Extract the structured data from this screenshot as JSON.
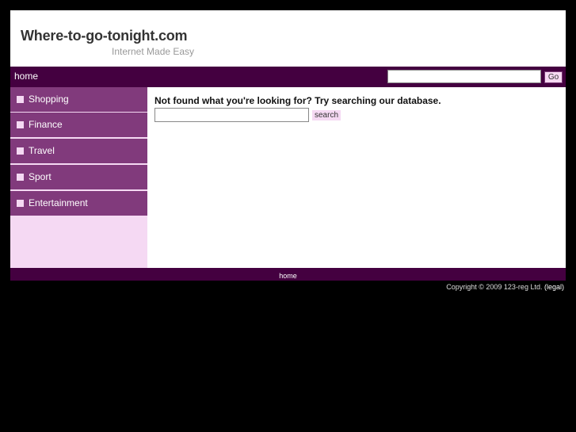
{
  "header": {
    "title": "Where-to-go-tonight.com",
    "tagline": "Internet Made Easy"
  },
  "topnav": {
    "home_label": "home",
    "search_value": "",
    "go_label": "Go"
  },
  "sidebar": {
    "items": [
      {
        "label": "Shopping"
      },
      {
        "label": "Finance"
      },
      {
        "label": "Travel"
      },
      {
        "label": "Sport"
      },
      {
        "label": "Entertainment"
      }
    ]
  },
  "main": {
    "heading": "Not found what you're looking for? Try searching our database.",
    "search_value": "",
    "search_label": "search"
  },
  "footer": {
    "home_label": "home",
    "copyright": "Copyright © 2009 123-reg Ltd.",
    "legal_label": "(legal)"
  },
  "colors": {
    "nav_bar": "#440040",
    "sidebar_item": "#813a7c",
    "sidebar_bg": "#f5d9f3",
    "page_bg": "#000000"
  }
}
